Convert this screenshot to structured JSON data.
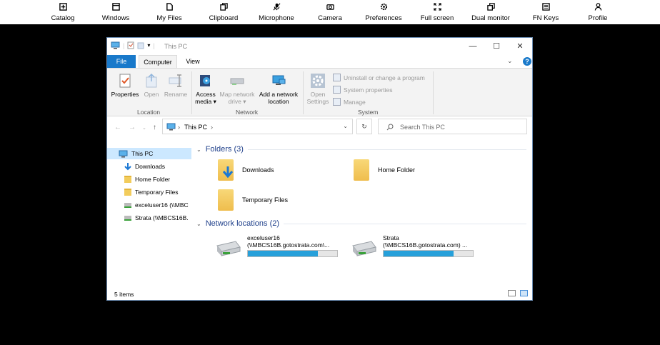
{
  "toolbar": {
    "items": [
      {
        "label": "Catalog",
        "icon": "plus-square-icon"
      },
      {
        "label": "Windows",
        "icon": "window-icon"
      },
      {
        "label": "My Files",
        "icon": "file-icon"
      },
      {
        "label": "Clipboard",
        "icon": "clipboard-icon"
      },
      {
        "label": "Microphone",
        "icon": "microphone-muted-icon"
      },
      {
        "label": "Camera",
        "icon": "camera-icon"
      },
      {
        "label": "Preferences",
        "icon": "gear-icon"
      },
      {
        "label": "Full screen",
        "icon": "fullscreen-icon"
      },
      {
        "label": "Dual monitor",
        "icon": "dual-monitor-icon"
      },
      {
        "label": "FN Keys",
        "icon": "keyboard-icon"
      },
      {
        "label": "Profile",
        "icon": "user-icon"
      }
    ]
  },
  "window": {
    "title": "This PC",
    "controls": {
      "minimize": "—",
      "maximize": "☐",
      "close": "✕"
    },
    "tabs": {
      "file": "File",
      "computer": "Computer",
      "view": "View"
    },
    "ribbon": {
      "properties": "Properties",
      "open": "Open",
      "rename": "Rename",
      "location_group": "Location",
      "access_media": "Access media ▾",
      "map_network_drive": "Map network drive ▾",
      "add_network_location": "Add a network location",
      "network_group": "Network",
      "open_settings": "Open Settings",
      "uninstall": "Uninstall or change a program",
      "system_properties": "System properties",
      "manage": "Manage",
      "system_group": "System"
    },
    "address": {
      "path": "This PC",
      "search_placeholder": "Search This PC"
    },
    "nav": {
      "this_pc": "This PC",
      "items": [
        {
          "label": "Downloads",
          "type": "download"
        },
        {
          "label": "Home Folder",
          "type": "folder"
        },
        {
          "label": "Temporary Files",
          "type": "folder"
        },
        {
          "label": "exceluser16 (\\\\MBC",
          "type": "drive"
        },
        {
          "label": "Strata (\\\\MBCS16B.",
          "type": "drive"
        }
      ]
    },
    "folders": {
      "header": "Folders (3)",
      "items": [
        "Downloads",
        "Home Folder",
        "Temporary Files"
      ]
    },
    "network": {
      "header": "Network locations (2)",
      "items": [
        {
          "name": "exceluser16",
          "path": "(\\\\MBCS16B.gotostrata.com\\...",
          "used": 0.78
        },
        {
          "name": "Strata",
          "path": "(\\\\MBCS16B.gotostrata.com) ...",
          "used": 0.78
        }
      ]
    },
    "status": "5 items"
  },
  "colors": {
    "accent": "#1979ca",
    "selection": "#cce8ff",
    "bar_fill": "#26a0da"
  }
}
